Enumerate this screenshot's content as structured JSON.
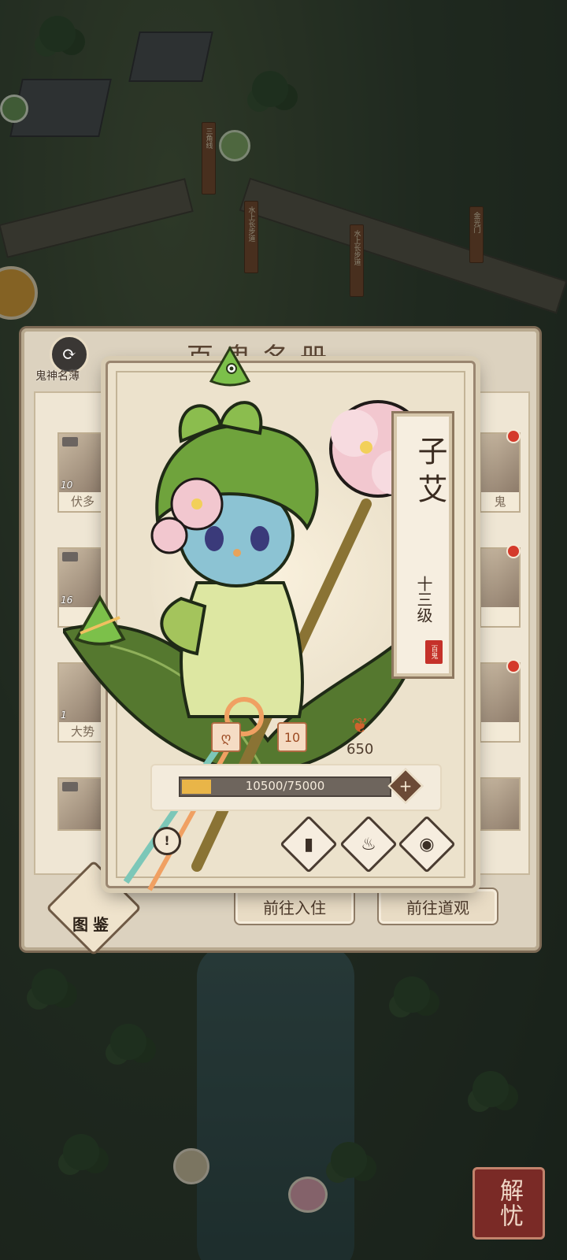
{
  "background": {
    "signs": [
      "水上长步道",
      "水上长步道",
      "金光门",
      "三角线"
    ]
  },
  "list_panel": {
    "header_label": "鬼神名薄",
    "title": "百鬼名册",
    "cards": [
      {
        "name": "伏多",
        "level": "10"
      },
      {
        "name": "",
        "level": "16"
      },
      {
        "name": "大势",
        "level": "1"
      },
      {
        "name": "",
        "level": ""
      }
    ],
    "right_cards": [
      {
        "name": "鬼"
      },
      {
        "name": ""
      },
      {
        "name": ""
      },
      {
        "name": ""
      }
    ],
    "button_move_in": "前往入住",
    "button_temple": "前往道观",
    "tujian_label": "图鉴"
  },
  "character": {
    "name": "子艾",
    "level": "十三级",
    "seal": "百鬼",
    "stat_level_badge": "10",
    "stat_value": "650",
    "progress_current": 10500,
    "progress_max": 75000,
    "progress_text": "10500/75000",
    "plus_label": "+",
    "actions": [
      "book-icon",
      "flame-icon",
      "pouch-icon"
    ]
  },
  "corner_button": "解忧",
  "colors": {
    "progress_fill": "#e9b548",
    "seal_red": "#c5312a",
    "red_dot": "#d43a2b"
  }
}
